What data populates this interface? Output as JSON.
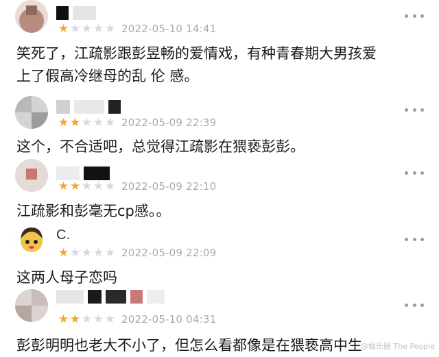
{
  "comments": [
    {
      "username": "",
      "rating": 1,
      "date": "2022-05-10 14:41",
      "text_lines": [
        "笑死了，江疏影跟彭昱畅的爱情戏，有种青春期大男孩爱",
        "上了假高冷继母的乱 伦 感。"
      ],
      "avatar_color": "#b98b7e"
    },
    {
      "username": "",
      "rating": 2,
      "date": "2022-05-09 22:39",
      "text_lines": [
        "这个，不合适吧，总觉得江疏影在猥亵彭彭。"
      ],
      "avatar_color": "#a7a7a7"
    },
    {
      "username": "",
      "rating": 2,
      "date": "2022-05-09 22:10",
      "text_lines": [
        "江疏影和彭毫无cp感。。"
      ],
      "avatar_color": "#c7796d"
    },
    {
      "username": "C.",
      "rating": 1,
      "date": "2022-05-09 22:09",
      "text_lines": [
        "这两人母子恋吗"
      ],
      "avatar_color": "#f2c44c"
    },
    {
      "username": "",
      "rating": 2,
      "date": "2022-05-10 04:31",
      "text_lines": [
        "彭彭明明也老大不小了，但怎么看都像是在猥亵高中生"
      ],
      "avatar_color": "#b7a5a2"
    }
  ],
  "watermark": "@娱乐圈  The People",
  "colors": {
    "star_on": "#f4a52a",
    "star_off": "#d8d8d8",
    "meta_gray": "#aaaaaa"
  }
}
